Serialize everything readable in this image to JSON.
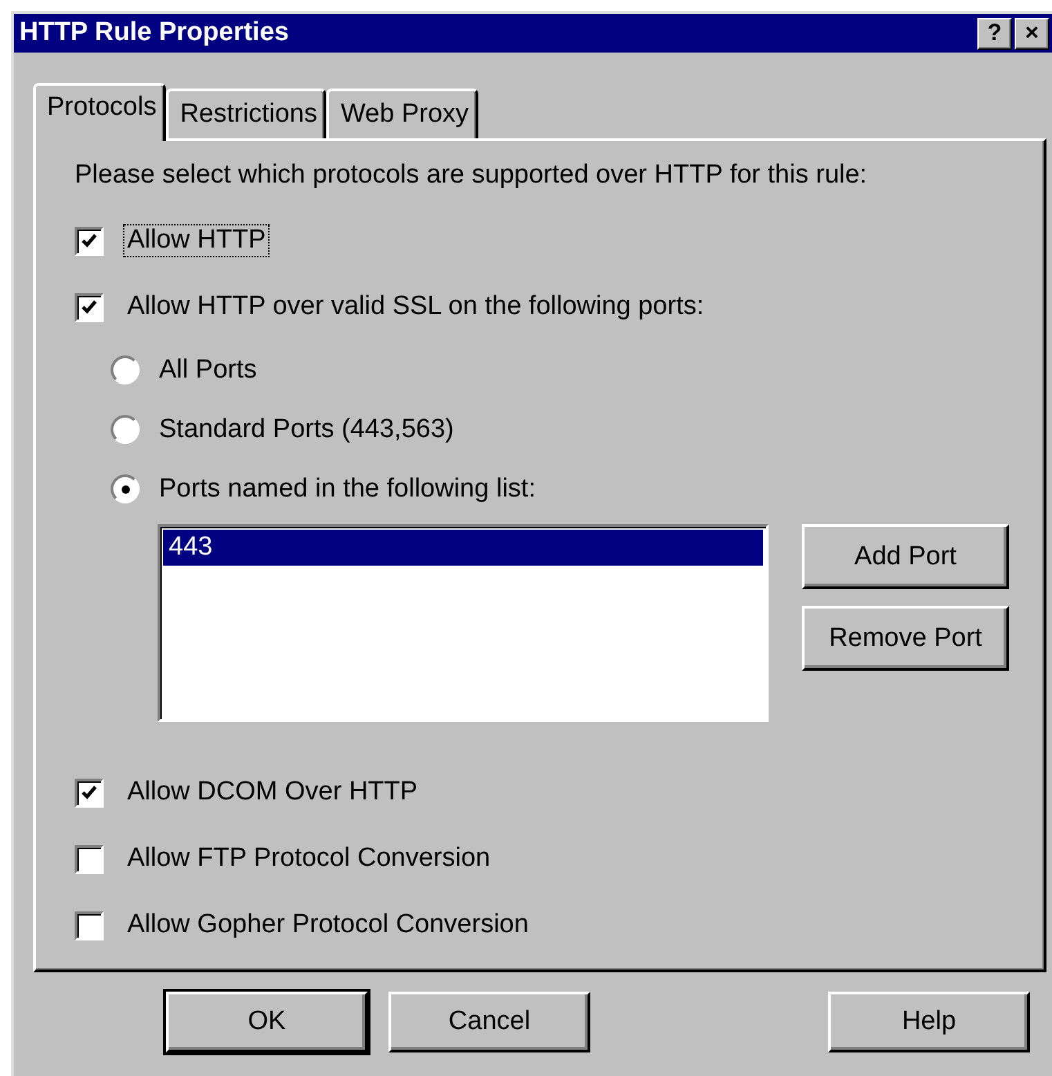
{
  "window": {
    "title": "HTTP Rule Properties",
    "controls": [
      "?",
      "×"
    ]
  },
  "tabs": [
    {
      "label": "Protocols",
      "selected": true
    },
    {
      "label": "Restrictions",
      "selected": false
    },
    {
      "label": "Web Proxy",
      "selected": false
    }
  ],
  "intro": "Please select which protocols are supported over HTTP for this rule:",
  "http_checks": [
    {
      "label": "Allow HTTP",
      "checked": true,
      "focused": true
    },
    {
      "label": "Allow HTTP over valid SSL on the following ports:",
      "checked": true,
      "focused": false
    }
  ],
  "port_options": [
    {
      "label": "All Ports",
      "selected": false
    },
    {
      "label": "Standard Ports (443,563)",
      "selected": false
    },
    {
      "label": "Ports named in the following list:",
      "selected": true
    }
  ],
  "port_list": [
    {
      "label": "443",
      "selected": true
    }
  ],
  "port_buttons": [
    "Add Port",
    "Remove Port"
  ],
  "more_checks": [
    {
      "label": "Allow DCOM Over HTTP",
      "checked": true,
      "focused": false
    },
    {
      "label": "Allow FTP Protocol Conversion",
      "checked": false,
      "focused": false
    },
    {
      "label": "Allow Gopher Protocol Conversion",
      "checked": false,
      "focused": false
    }
  ],
  "buttons": [
    {
      "label": "OK",
      "default": true
    },
    {
      "label": "Cancel",
      "default": false
    },
    {
      "label": "Help",
      "default": false
    }
  ]
}
